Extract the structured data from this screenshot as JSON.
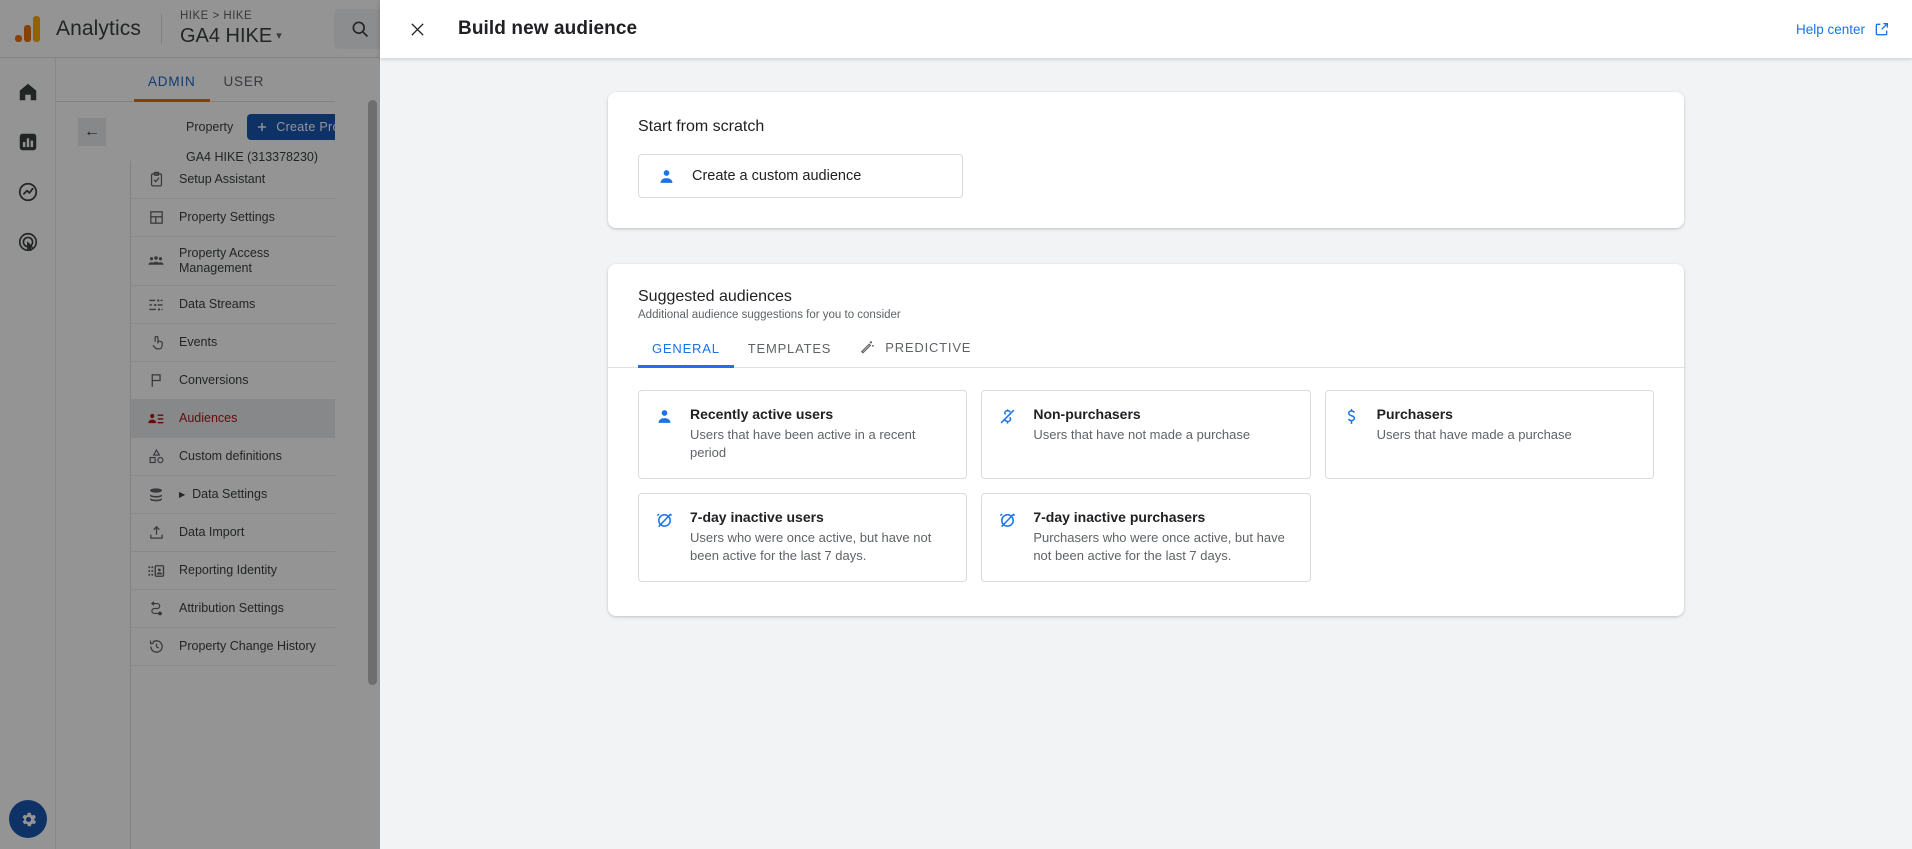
{
  "app": {
    "brand": "Analytics",
    "breadcrumb": "HIKE > HIKE",
    "account_selector": "GA4 HIKE",
    "caret": "▾",
    "search_placeholder": "Search",
    "rail": [
      {
        "name": "home-icon",
        "label": "Home"
      },
      {
        "name": "reports-icon",
        "label": "Reports"
      },
      {
        "name": "explore-icon",
        "label": "Explore"
      },
      {
        "name": "advertising-icon",
        "label": "Advertising"
      }
    ],
    "settings_button_label": "Admin settings"
  },
  "admin": {
    "tabs": [
      {
        "label": "ADMIN",
        "active": true
      },
      {
        "label": "USER",
        "active": false
      }
    ],
    "property_label": "Property",
    "create_property_label": "Create Property",
    "property_id": "GA4 HIKE (313378230)",
    "back_arrow": "←",
    "nav_items": [
      {
        "label": "Setup Assistant",
        "icon": "checklist-icon",
        "selected": false,
        "expandable": false
      },
      {
        "label": "Property Settings",
        "icon": "property-settings-icon",
        "selected": false,
        "expandable": false
      },
      {
        "label": "Property Access Management",
        "icon": "people-icon",
        "selected": false,
        "expandable": false
      },
      {
        "label": "Data Streams",
        "icon": "data-streams-icon",
        "selected": false,
        "expandable": false
      },
      {
        "label": "Events",
        "icon": "tap-icon",
        "selected": false,
        "expandable": false
      },
      {
        "label": "Conversions",
        "icon": "flag-icon",
        "selected": false,
        "expandable": false
      },
      {
        "label": "Audiences",
        "icon": "audiences-icon",
        "selected": true,
        "expandable": false
      },
      {
        "label": "Custom definitions",
        "icon": "shapes-icon",
        "selected": false,
        "expandable": false
      },
      {
        "label": "Data Settings",
        "icon": "database-icon",
        "selected": false,
        "expandable": true
      },
      {
        "label": "Data Import",
        "icon": "upload-icon",
        "selected": false,
        "expandable": false
      },
      {
        "label": "Reporting Identity",
        "icon": "identity-icon",
        "selected": false,
        "expandable": false
      },
      {
        "label": "Attribution Settings",
        "icon": "attribution-icon",
        "selected": false,
        "expandable": false
      },
      {
        "label": "Property Change History",
        "icon": "history-icon",
        "selected": false,
        "expandable": false
      }
    ]
  },
  "modal": {
    "title": "Build new audience",
    "close_label": "Close",
    "help_label": "Help center",
    "scratch": {
      "title": "Start from scratch",
      "button_label": "Create a custom audience",
      "button_icon": "person-icon"
    },
    "suggested": {
      "title": "Suggested audiences",
      "subtitle": "Additional audience suggestions for you to consider",
      "tabs": [
        {
          "label": "GENERAL",
          "active": true,
          "icon": null
        },
        {
          "label": "TEMPLATES",
          "active": false,
          "icon": null
        },
        {
          "label": "PREDICTIVE",
          "active": false,
          "icon": "magic-wand-icon"
        }
      ],
      "items": [
        {
          "name": "Recently active users",
          "description": "Users that have been active in a recent period",
          "icon": "person-icon"
        },
        {
          "name": "Non-purchasers",
          "description": "Users that have not made a purchase",
          "icon": "money-off-icon"
        },
        {
          "name": "Purchasers",
          "description": "Users that have made a purchase",
          "icon": "dollar-icon"
        },
        {
          "name": "7-day inactive users",
          "description": "Users who were once active, but have not been active for the last 7 days.",
          "icon": "alarm-off-icon"
        },
        {
          "name": "7-day inactive purchasers",
          "description": "Purchasers who were once active, but have not been active for the last 7 days.",
          "icon": "alarm-off-icon"
        }
      ]
    }
  },
  "colors": {
    "accent_blue": "#1a73e8",
    "brand_orange": "#e8710a",
    "brand_yellow": "#f9ab00",
    "selected_red": "#b31412",
    "button_blue": "#1a56b0",
    "surface_gray": "#f1f3f4"
  }
}
